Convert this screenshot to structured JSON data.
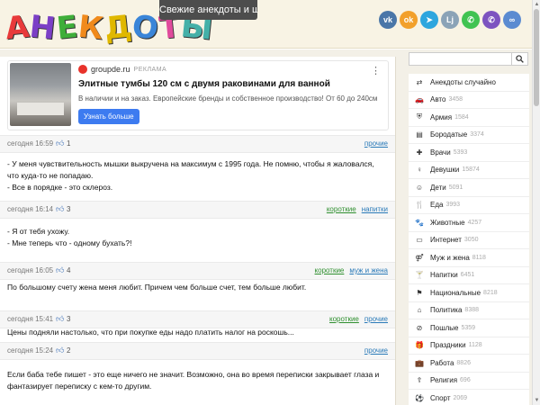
{
  "header": {
    "logo_letters": [
      "A",
      "Н",
      "Е",
      "К",
      "Д",
      "О",
      "Т",
      "Ы"
    ],
    "logo_colors": [
      "#e83a3a",
      "#7b3fc6",
      "#3fae3a",
      "#f08a1c",
      "#e0b800",
      "#3a85d8",
      "#e04a9c",
      "#44b0a8"
    ],
    "tagline": "Свежие анекдоты и шутки",
    "social": [
      {
        "icon": "vk-icon",
        "glyph": "vk",
        "color": "#4a76a8"
      },
      {
        "icon": "odnoklassniki-icon",
        "glyph": "ok",
        "color": "#f2a02b"
      },
      {
        "icon": "telegram-icon",
        "glyph": "➤",
        "color": "#2ea6de"
      },
      {
        "icon": "livejournal-icon",
        "glyph": "Lj",
        "color": "#8ba3b7"
      },
      {
        "icon": "whatsapp-icon",
        "glyph": "✆",
        "color": "#41c352"
      },
      {
        "icon": "viber-icon",
        "glyph": "✆",
        "color": "#7d53c0"
      },
      {
        "icon": "link-icon",
        "glyph": "∞",
        "color": "#5b8bd1"
      }
    ]
  },
  "ad": {
    "domain": "groupde.ru",
    "mark": "РЕКЛАМА",
    "title": "Элитные тумбы 120 см с двумя раковинами для ванной",
    "text": "В наличии и на заказ. Европейские бренды и собственное производство! От 60 до 240см",
    "button": "Узнать больше"
  },
  "jokes": [
    {
      "date": "сегодня 16:59",
      "likes": "1",
      "cats": [
        {
          "label": "прочие",
          "green": false
        }
      ],
      "text": ""
    },
    {
      "date": "сегодня 16:14",
      "likes": "3",
      "cats": [
        {
          "label": "короткие",
          "green": true
        },
        {
          "label": "напитки",
          "green": false
        }
      ],
      "text": "- У меня чувствительность мышки выкручена на максимум с 1995 года. Не помню, чтобы я жаловался, что куда-то не попадаю.\n- Все в порядке - это склероз."
    },
    {
      "date": "сегодня 16:05",
      "likes": "4",
      "cats": [
        {
          "label": "короткие",
          "green": true
        },
        {
          "label": "муж и жена",
          "green": false
        }
      ],
      "text": "- Я от тебя ухожу.\n- Мне теперь что - одному бухать?!"
    },
    {
      "date": "сегодня 15:41",
      "likes": "3",
      "cats": [
        {
          "label": "короткие",
          "green": true
        },
        {
          "label": "прочие",
          "green": false
        }
      ],
      "text": "По большому счету жена меня любит. Причем чем больше счет, тем больше любит."
    },
    {
      "date": "сегодня 15:24",
      "likes": "2",
      "cats": [
        {
          "label": "прочие",
          "green": false
        }
      ],
      "text": "Цены подняли настолько, что при покупке еды надо платить налог на роскошь..."
    },
    {
      "date": "",
      "likes": "",
      "cats": [],
      "text": "Если баба тебе пишет - это еще ничего не значит. Возможно, она во время переписки закрывает глаза и фантазирует переписку с кем-то другим."
    }
  ],
  "sidebar": {
    "search_placeholder": "",
    "items": [
      {
        "icon": "shuffle-icon",
        "glyph": "⇄",
        "label": "Анекдоты случайно",
        "count": ""
      },
      {
        "icon": "car-icon",
        "glyph": "🚗",
        "label": "Авто",
        "count": "3458"
      },
      {
        "icon": "army-icon",
        "glyph": "⛨",
        "label": "Армия",
        "count": "1584"
      },
      {
        "icon": "book-icon",
        "glyph": "▤",
        "label": "Бородатые",
        "count": "3374"
      },
      {
        "icon": "doctor-icon",
        "glyph": "✚",
        "label": "Врачи",
        "count": "5393"
      },
      {
        "icon": "female-icon",
        "glyph": "♀",
        "label": "Девушки",
        "count": "15874"
      },
      {
        "icon": "child-icon",
        "glyph": "☺",
        "label": "Дети",
        "count": "5091"
      },
      {
        "icon": "food-icon",
        "glyph": "🍴",
        "label": "Еда",
        "count": "3993"
      },
      {
        "icon": "paw-icon",
        "glyph": "🐾",
        "label": "Животные",
        "count": "4257"
      },
      {
        "icon": "monitor-icon",
        "glyph": "▭",
        "label": "Интернет",
        "count": "3050"
      },
      {
        "icon": "couple-icon",
        "glyph": "⚤",
        "label": "Муж и жена",
        "count": "8118"
      },
      {
        "icon": "glass-icon",
        "glyph": "🍸",
        "label": "Напитки",
        "count": "6451"
      },
      {
        "icon": "flag-icon",
        "glyph": "⚑",
        "label": "Национальные",
        "count": "8218"
      },
      {
        "icon": "bank-icon",
        "glyph": "⌂",
        "label": "Политика",
        "count": "8388"
      },
      {
        "icon": "ban-icon",
        "glyph": "⊘",
        "label": "Пошлые",
        "count": "5359"
      },
      {
        "icon": "gift-icon",
        "glyph": "🎁",
        "label": "Праздники",
        "count": "1128"
      },
      {
        "icon": "briefcase-icon",
        "glyph": "💼",
        "label": "Работа",
        "count": "8826"
      },
      {
        "icon": "religion-icon",
        "glyph": "☦",
        "label": "Религия",
        "count": "696"
      },
      {
        "icon": "soccer-ball-icon",
        "glyph": "⚽",
        "label": "Спорт",
        "count": "2069"
      }
    ]
  }
}
